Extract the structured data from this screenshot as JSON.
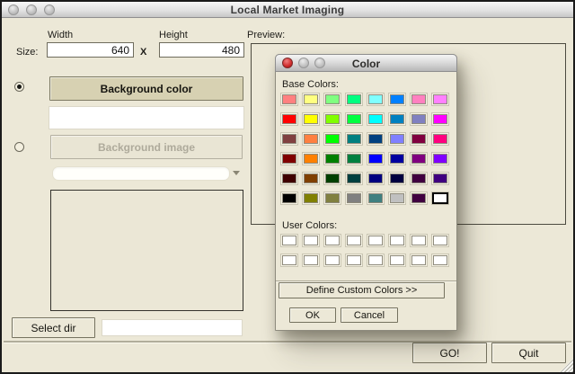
{
  "window": {
    "title": "Local Market Imaging",
    "size_section": {
      "size_label": "Size:",
      "width_label": "Width",
      "width_value": "640",
      "separator": "X",
      "height_label": "Height",
      "height_value": "480"
    },
    "preview_label": "Preview:",
    "background_section": {
      "color_radio_selected": true,
      "color_button_label": "Background color",
      "color_value": "",
      "image_radio_selected": false,
      "image_button_label": "Background image",
      "image_combo_value": ""
    },
    "select_dir_button": "Select dir",
    "dir_field_value": "",
    "go_button": "GO!",
    "quit_button": "Quit"
  },
  "color_dialog": {
    "title": "Color",
    "base_colors_label": "Base Colors:",
    "base_colors": [
      "#FF8080",
      "#FFFF80",
      "#80FF80",
      "#00FF80",
      "#80FFFF",
      "#0080FF",
      "#FF80C0",
      "#FF80FF",
      "#FF0000",
      "#FFFF00",
      "#80FF00",
      "#00FF40",
      "#00FFFF",
      "#0080C0",
      "#8080C0",
      "#FF00FF",
      "#804040",
      "#FF8040",
      "#00FF00",
      "#008080",
      "#004080",
      "#8080FF",
      "#800040",
      "#FF0080",
      "#800000",
      "#FF8000",
      "#008000",
      "#008040",
      "#0000FF",
      "#0000A0",
      "#800080",
      "#8000FF",
      "#400000",
      "#804000",
      "#004000",
      "#004040",
      "#000080",
      "#000040",
      "#400040",
      "#400080",
      "#000000",
      "#808000",
      "#808040",
      "#808080",
      "#408080",
      "#C0C0C0",
      "#400040",
      "#FFFFFF"
    ],
    "selected_base_index": 47,
    "user_colors_label": "User Colors:",
    "user_colors": [
      "#FFFFFF",
      "#FFFFFF",
      "#FFFFFF",
      "#FFFFFF",
      "#FFFFFF",
      "#FFFFFF",
      "#FFFFFF",
      "#FFFFFF",
      "#FFFFFF",
      "#FFFFFF",
      "#FFFFFF",
      "#FFFFFF",
      "#FFFFFF",
      "#FFFFFF",
      "#FFFFFF",
      "#FFFFFF"
    ],
    "define_custom_button": "Define Custom Colors >>",
    "ok_button": "OK",
    "cancel_button": "Cancel"
  },
  "theme": {
    "window_bg": "#ECE8D7",
    "tan_button": "#D7D1B2",
    "titlebar_gray": "#C6C6C6",
    "close_button_red": "#CF2B2B"
  }
}
